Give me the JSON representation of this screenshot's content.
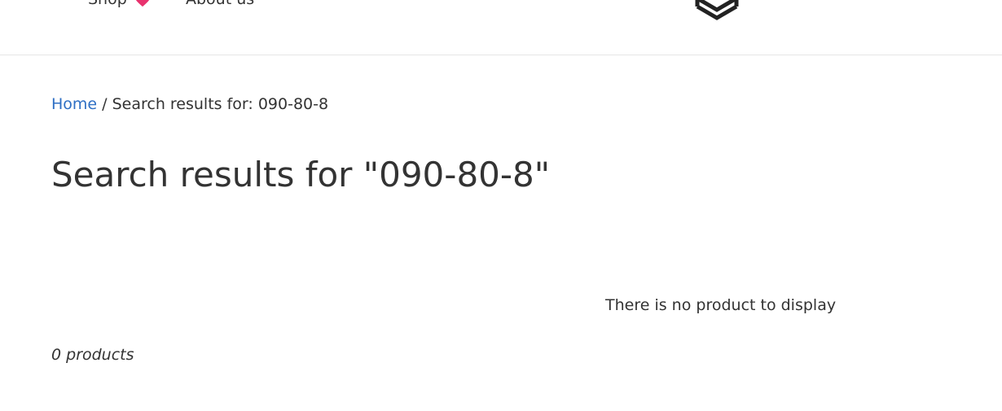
{
  "header": {
    "nav": [
      {
        "label": "Shop",
        "icon": "heart-icon",
        "icon_color": "#e8326e"
      },
      {
        "label": "About us"
      }
    ],
    "logo_icon": "layered-chevron-logo-icon",
    "border_color": "#e6e6e6"
  },
  "breadcrumb": {
    "home_label": "Home",
    "separator": " / ",
    "current": "Search results for: 090-80-8",
    "link_color": "#2e6fc4"
  },
  "page_title": "Search results for \"090-80-8\"",
  "empty_message": "There is no product to display",
  "product_count": "0 products"
}
